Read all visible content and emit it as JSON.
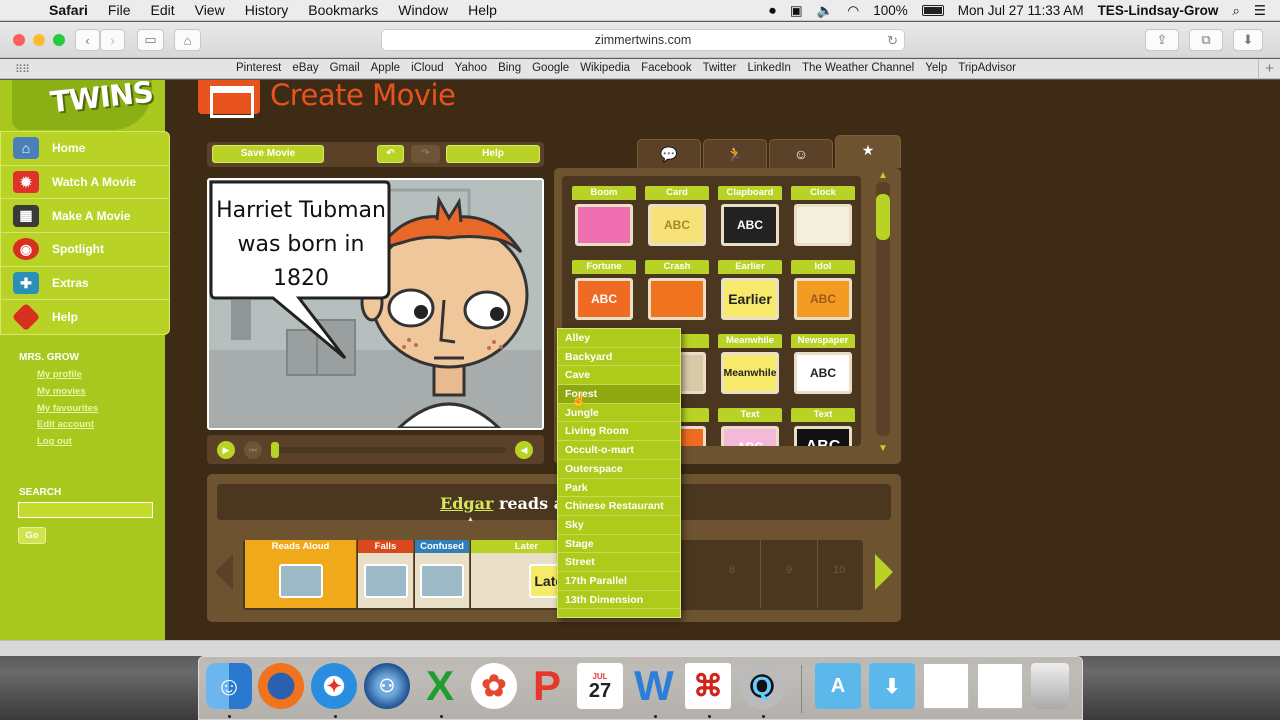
{
  "menubar": {
    "app": "Safari",
    "items": [
      "File",
      "Edit",
      "View",
      "History",
      "Bookmarks",
      "Window",
      "Help"
    ],
    "battery": "100%",
    "datetime": "Mon Jul 27  11:33 AM",
    "user": "TES-Lindsay-Grow"
  },
  "browser": {
    "url": "zimmertwins.com",
    "favorites": [
      "Pinterest",
      "eBay",
      "Gmail",
      "Apple",
      "iCloud",
      "Yahoo",
      "Bing",
      "Google",
      "Wikipedia",
      "Facebook",
      "Twitter",
      "LinkedIn",
      "The Weather Channel",
      "Yelp",
      "TripAdvisor"
    ]
  },
  "site": {
    "logo": "TWINS",
    "page_title": "Create Movie",
    "nav": [
      {
        "label": "Home",
        "icon": "house-icon",
        "color": "#4a7fb8"
      },
      {
        "label": "Watch A Movie",
        "icon": "popcorn-icon",
        "color": "#e0322a"
      },
      {
        "label": "Make A Movie",
        "icon": "clapboard-icon",
        "color": "#3a3a3a"
      },
      {
        "label": "Spotlight",
        "icon": "spotlight-icon",
        "color": "#d8301f"
      },
      {
        "label": "Extras",
        "icon": "extras-icon",
        "color": "#2b8fb8"
      },
      {
        "label": "Help",
        "icon": "help-icon",
        "color": "#d8301f"
      }
    ],
    "user_name": "MRS. GROW",
    "user_links": [
      "My profile",
      "My movies",
      "My favourites",
      "Edit account",
      "Log out"
    ],
    "search_label": "SEARCH",
    "search_value": "",
    "go_label": "Go"
  },
  "editor": {
    "save_label": "Save Movie",
    "help_label": "Help",
    "speech_text": "Harriet Tubman was born in 1820",
    "tabs": [
      "speech-icon",
      "action-icon",
      "emotion-icon",
      "star-icon"
    ],
    "props": [
      {
        "label": "Boom",
        "content": "",
        "color": "#f06fb0"
      },
      {
        "label": "Card",
        "content": "ABC",
        "color": "#f7e27a"
      },
      {
        "label": "Clapboard",
        "content": "ABC",
        "color": "#222222"
      },
      {
        "label": "Clock",
        "content": "",
        "color": "#f3f0dd"
      },
      {
        "label": "Fortune",
        "content": "ABC",
        "color": "#ef6a22"
      },
      {
        "label": "Crash",
        "content": "",
        "color": "#f0731d"
      },
      {
        "label": "Earlier",
        "content": "Earlier",
        "color": "#f7ea6a"
      },
      {
        "label": "Idol",
        "content": "ABC",
        "color": "#f39b22"
      },
      {
        "label": "",
        "content": "",
        "color": ""
      },
      {
        "label": "",
        "content": "",
        "color": ""
      },
      {
        "label": "Meanwhile",
        "content": "Meanwhile",
        "color": "#f7ea6a"
      },
      {
        "label": "Newspaper",
        "content": "ABC",
        "color": "#ffffff"
      },
      {
        "label": "",
        "content": "",
        "color": ""
      },
      {
        "label": "",
        "content": "",
        "color": ""
      },
      {
        "label": "Text",
        "content": "ABC",
        "color": "#f4b8d8"
      },
      {
        "label": "Text",
        "content": "ABC",
        "color": "#111111"
      }
    ],
    "backgrounds": [
      "Alley",
      "Backyard",
      "Cave",
      "Forest",
      "Jungle",
      "Living Room",
      "Occult-o-mart",
      "Outerspace",
      "Park",
      "Chinese Restaurant",
      "Sky",
      "Stage",
      "Street",
      "17th Parallel",
      "13th Dimension"
    ],
    "selected_background": "Forest",
    "caption_name": "Edgar",
    "caption_rest": " reads alou",
    "frames": [
      {
        "label": "Reads Aloud",
        "color": "#f1a91c"
      },
      {
        "label": "Falls",
        "color": "#d84a1c"
      },
      {
        "label": "Confused",
        "color": "#2f7fb8"
      },
      {
        "label": "Later",
        "color": "#b8d325"
      }
    ],
    "later_text": "Later",
    "empty_frames": [
      "8",
      "9",
      "10"
    ]
  },
  "dock": {
    "calendar_month": "JUL",
    "calendar_day": "27"
  }
}
